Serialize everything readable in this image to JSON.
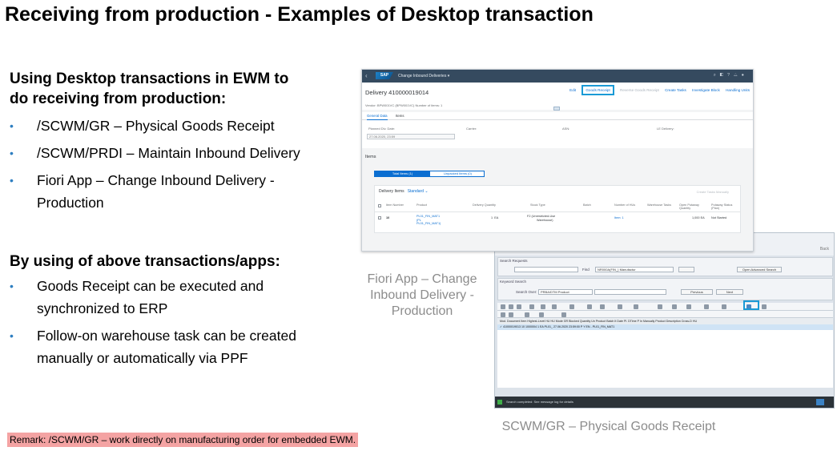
{
  "slide": {
    "title": "Receiving from production - Examples of Desktop transaction",
    "section1_heading_line1": "Using Desktop transactions in EWM to",
    "section1_heading_line2": "do receiving from production:",
    "bullets1": [
      "/SCWM/GR – Physical Goods Receipt",
      "/SCWM/PRDI – Maintain Inbound Delivery",
      "Fiori App – Change Inbound Delivery -",
      "Production"
    ],
    "section2_heading": "By using of above transactions/apps:",
    "bullets2": [
      "Goods Receipt can be executed and",
      "synchronized to ERP",
      "Follow-on warehouse task can be created",
      "manually or automatically via PPF"
    ],
    "caption_fiori": [
      "Fiori App – Change",
      "Inbound Delivery -",
      "Production"
    ],
    "caption_gr": "SCWM/GR – Physical Goods Receipt",
    "remark": "Remark: /SCWM/GR – work directly on manufacturing order for embedded EWM.",
    "colors": {
      "bullet": "#2f7fc1",
      "highlight": "#1a9ad6",
      "remark_bg": "#f4a3a3",
      "shell": "#354a5f"
    }
  },
  "fiori": {
    "logo": "SAP",
    "app_title": "Change Inbound Deliveries ▾",
    "object_title": "Delivery 410000019014",
    "actions": {
      "edit": "Edit",
      "goods_receipt": "Goods Receipt",
      "reverse_gr": "Reverse Goods Receipt",
      "create_tasks": "Create Tasks",
      "investigate_block": "Investigate Block",
      "handling_units": "Handling Units"
    },
    "vendor_line": "Vendor: BPW001VC (BPW001VC)   Number of items: 1",
    "tabs": [
      "General Data",
      "Items"
    ],
    "general": {
      "planned_label": "Planned Dlv. Date:",
      "planned_value": "27.06.2020, 23:59",
      "carrier_label": "Carrier:",
      "asn_label": "ASN:",
      "le_delivery_label": "LE Delivery:"
    },
    "items_title": "Items",
    "segments": {
      "total": "Total Items (1)",
      "unpacked": "Unpacked Items (0)"
    },
    "table": {
      "title": "Delivery Items",
      "variant": "Standard ⌄",
      "create_tasks": "Create Tasks Manually",
      "columns": [
        "Item Number",
        "Product",
        "Delivery Quantity",
        "Stock Type",
        "Batch",
        "Number of HUs",
        "Warehouse Tasks",
        "Open Putaway Quantity",
        "Putaway Status (Plan)"
      ],
      "row": {
        "item": "10",
        "product": [
          "PL01_FIN_MAT1",
          "(PL",
          "PL01_FIN_MAT1)"
        ],
        "qty": "1",
        "uom": "EA",
        "stock_type": [
          "F2 (Unrestricted-Use",
          "Warehouse)"
        ],
        "hus": "Item: 1",
        "open_qty": "1,000",
        "open_uom": "EA",
        "status": "Not Started"
      }
    }
  },
  "gr": {
    "back": "Back",
    "search_requests": "Search Requests",
    "find_label": "Find",
    "find_value": "NR000A(FIN_) Manufactur",
    "open_advanced": "Open Advanced Search",
    "keyword_search": "Keyword Search",
    "search_by_label": "Search Over:",
    "search_by_value": "PRBA/DTM Product",
    "btn_prev": "Previous",
    "btn_next": "Next",
    "grid_header": "Mod. Document      Item  Highest-Level HU  HU  Mode  GR  Blocked  Quantity  Un  Product Batch  It  Date Pl.  DTime P  In  Manually  Product Description     Cross-D  HU",
    "grid_row": "✓  41000019013            10  1000004                         1 EA  PL01_      27.06.2020  23:59:00  P  Y     EN - PL01_FIN_MAT1",
    "status_text": "Search completed: See message log for details"
  }
}
